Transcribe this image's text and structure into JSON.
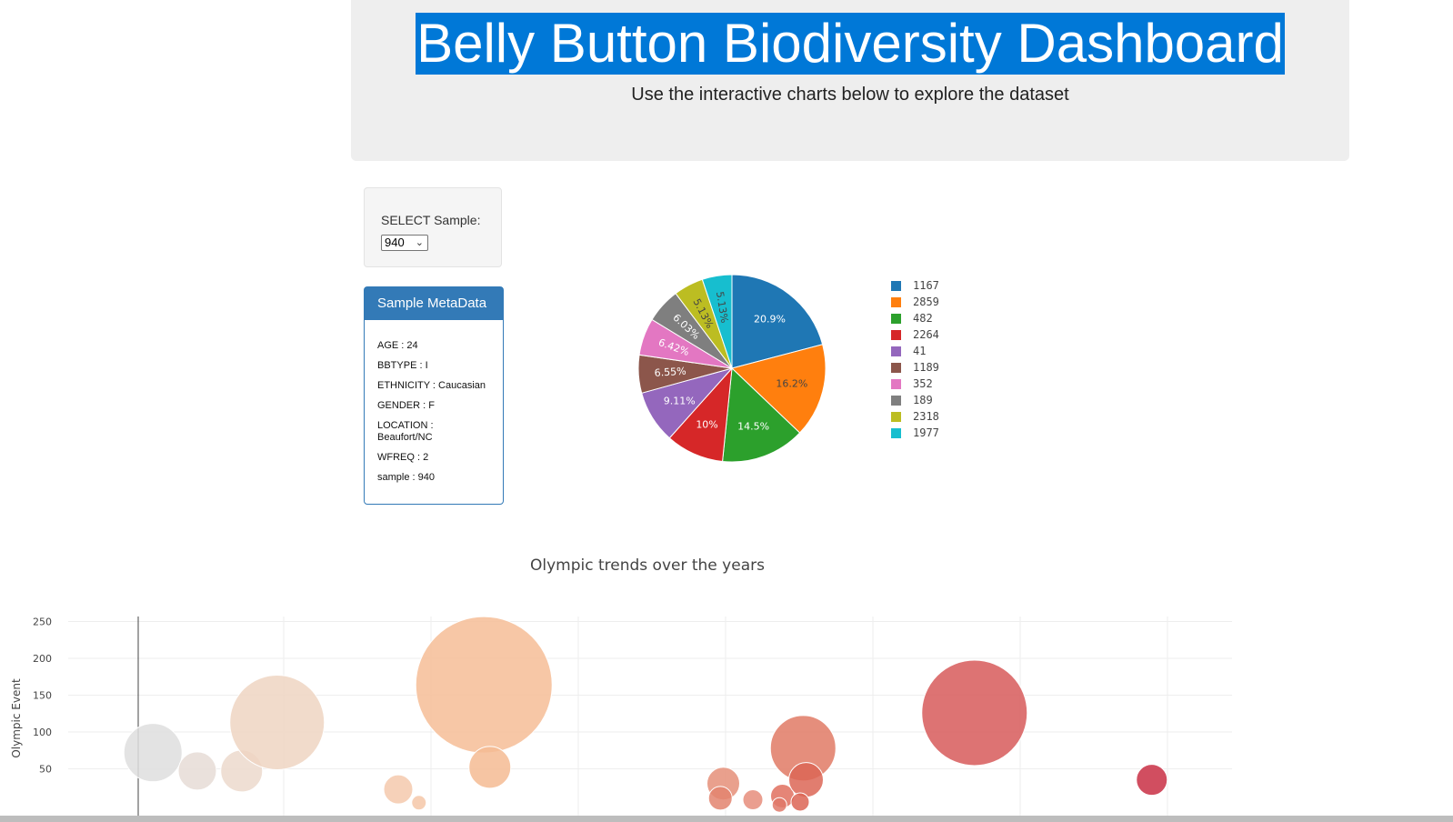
{
  "header": {
    "title": "Belly Button Biodiversity Dashboard",
    "subtitle": "Use the interactive charts below to explore the dataset"
  },
  "selector": {
    "label": "SELECT Sample:",
    "selected": "940"
  },
  "metadata_panel": {
    "heading": "Sample MetaData",
    "lines": [
      "AGE : 24",
      "BBTYPE : I",
      "ETHNICITY : Caucasian",
      "GENDER : F",
      "LOCATION : Beaufort/NC",
      "WFREQ : 2",
      "sample : 940"
    ]
  },
  "chart_data": [
    {
      "type": "pie",
      "labels": [
        "1167",
        "2859",
        "482",
        "2264",
        "41",
        "1189",
        "352",
        "189",
        "2318",
        "1977"
      ],
      "values": [
        20.9,
        16.2,
        14.5,
        10,
        9.11,
        6.55,
        6.42,
        6.03,
        5.13,
        5.13
      ],
      "value_labels": [
        "20.9%",
        "16.2%",
        "14.5%",
        "10%",
        "9.11%",
        "6.55%",
        "6.42%",
        "6.03%",
        "5.13%",
        "5.13%"
      ],
      "colors": [
        "#1f77b4",
        "#ff7f0e",
        "#2ca02c",
        "#d62728",
        "#9467bd",
        "#8c564b",
        "#e377c2",
        "#7f7f7f",
        "#bcbd22",
        "#17becf"
      ],
      "legend_placement": "right"
    },
    {
      "type": "scatter",
      "title": "Olympic trends over the years",
      "ylabel": "Olympic Event",
      "yticks": [
        50,
        100,
        150,
        200,
        250
      ],
      "grid": true,
      "points": [
        {
          "x": 0.5,
          "y": 72,
          "r": 32,
          "color": "#dedede"
        },
        {
          "x": 2.0,
          "y": 47,
          "r": 21,
          "color": "#e6dcd6"
        },
        {
          "x": 3.5,
          "y": 47,
          "r": 23,
          "color": "#ecd9cc"
        },
        {
          "x": 4.7,
          "y": 113,
          "r": 52,
          "color": "#efd5c2"
        },
        {
          "x": 8.8,
          "y": 22,
          "r": 16,
          "color": "#f5c9ad"
        },
        {
          "x": 9.5,
          "y": 4,
          "r": 8,
          "color": "#f5c7a8"
        },
        {
          "x": 11.7,
          "y": 164,
          "r": 75,
          "color": "#f6bd97"
        },
        {
          "x": 11.9,
          "y": 52,
          "r": 23,
          "color": "#f5bb93"
        },
        {
          "x": 19.8,
          "y": 30,
          "r": 18,
          "color": "#e58f79"
        },
        {
          "x": 19.7,
          "y": 10,
          "r": 13,
          "color": "#e3846f"
        },
        {
          "x": 20.8,
          "y": 8,
          "r": 11,
          "color": "#e68d7b"
        },
        {
          "x": 21.8,
          "y": 13,
          "r": 13,
          "color": "#e0705f"
        },
        {
          "x": 21.7,
          "y": 1,
          "r": 8,
          "color": "#e07868"
        },
        {
          "x": 22.5,
          "y": 78,
          "r": 36,
          "color": "#e07a65"
        },
        {
          "x": 22.6,
          "y": 35,
          "r": 19,
          "color": "#dc6656"
        },
        {
          "x": 22.4,
          "y": 5,
          "r": 10,
          "color": "#dc6454"
        },
        {
          "x": 28.3,
          "y": 126,
          "r": 58,
          "color": "#d75b5b"
        },
        {
          "x": 34.3,
          "y": 35,
          "r": 17,
          "color": "#c92f44"
        }
      ]
    }
  ]
}
